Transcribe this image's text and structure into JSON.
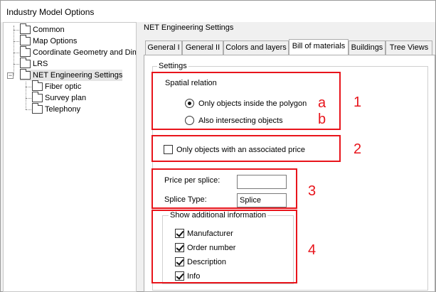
{
  "window": {
    "title": "Industry Model Options"
  },
  "tree": {
    "items": [
      {
        "label": "Common"
      },
      {
        "label": "Map Options"
      },
      {
        "label": "Coordinate Geometry and Dime"
      },
      {
        "label": "LRS"
      },
      {
        "label": "NET Engineering Settings"
      },
      {
        "label": "Fiber optic"
      },
      {
        "label": "Survey plan"
      },
      {
        "label": "Telephony"
      }
    ],
    "expander_symbol": "−"
  },
  "panel": {
    "title": "NET Engineering Settings",
    "tabs": [
      {
        "label": "General I"
      },
      {
        "label": "General II"
      },
      {
        "label": "Colors and layers"
      },
      {
        "label": "Bill of materials"
      },
      {
        "label": "Buildings"
      },
      {
        "label": "Tree Views"
      }
    ],
    "active_tab": "Bill of materials"
  },
  "settings": {
    "group_label": "Settings",
    "spatial_relation": {
      "label": "Spatial relation",
      "options": [
        {
          "label": "Only objects inside the polygon",
          "selected": true
        },
        {
          "label": "Also intersecting objects",
          "selected": false
        }
      ]
    },
    "price_only": {
      "label": "Only objects with an associated price",
      "checked": false
    },
    "price_per_splice": {
      "label": "Price per splice:",
      "value": ""
    },
    "splice_type": {
      "label": "Splice Type:",
      "value": "Splice"
    },
    "additional_info": {
      "label": "Show additional information",
      "items": [
        {
          "label": "Manufacturer",
          "checked": true
        },
        {
          "label": "Order number",
          "checked": true
        },
        {
          "label": "Description",
          "checked": true
        },
        {
          "label": "Info",
          "checked": true
        }
      ]
    }
  },
  "annotations": {
    "color": "#e8141b",
    "labels": [
      "1",
      "2",
      "3",
      "4",
      "a",
      "b"
    ]
  }
}
